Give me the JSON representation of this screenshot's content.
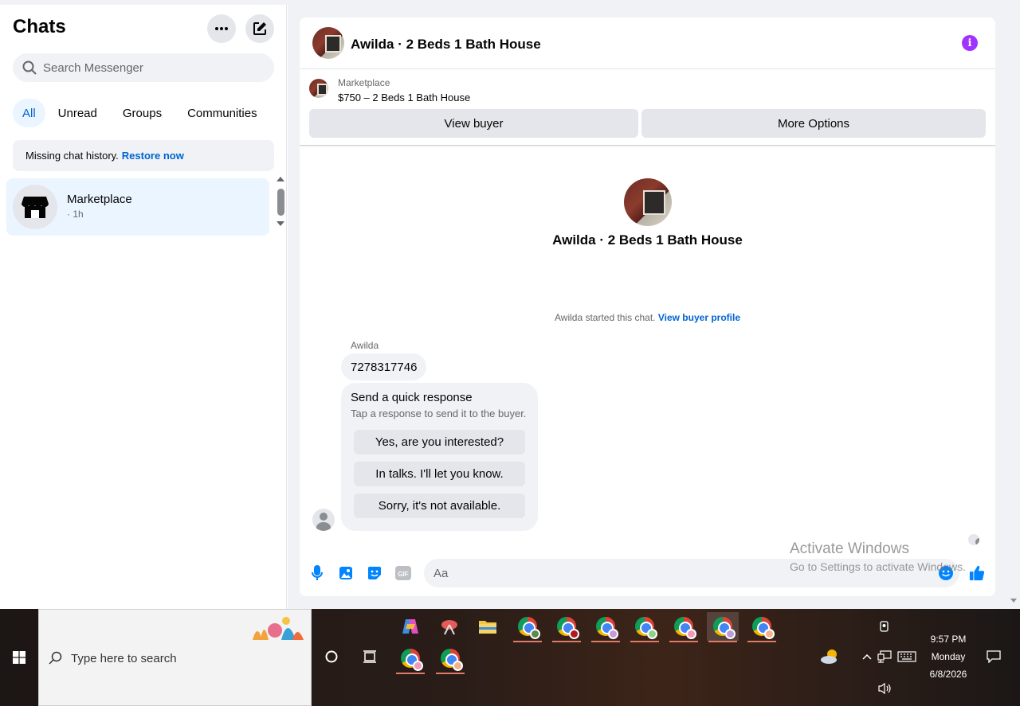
{
  "sidebar": {
    "title": "Chats",
    "search_placeholder": "Search Messenger",
    "filters": [
      "All",
      "Unread",
      "Groups",
      "Communities"
    ],
    "missing_history": {
      "text": "Missing chat history.",
      "link": "Restore now"
    },
    "chats": [
      {
        "name": "Marketplace",
        "time": "· 1h"
      }
    ]
  },
  "conversation": {
    "title": "Awilda · 2 Beds 1 Bath House",
    "marketplace_label": "Marketplace",
    "listing": "$750 – 2 Beds 1 Bath House",
    "view_buyer": "View buyer",
    "more_options": "More Options",
    "intro_name": "Awilda · 2 Beds 1 Bath House",
    "started_text": "Awilda started this chat.",
    "started_link": "View buyer profile",
    "sender": "Awilda",
    "message": "7278317746",
    "quick_response": {
      "title": "Send a quick response",
      "subtitle": "Tap a response to send it to the buyer.",
      "options": [
        "Yes, are you interested?",
        "In talks. I'll let you know.",
        "Sorry, it's not available."
      ]
    },
    "composer_placeholder": "Aa"
  },
  "watermark": {
    "line1": "Activate Windows",
    "line2": "Go to Settings to activate Windows."
  },
  "taskbar": {
    "search_placeholder": "Type here to search",
    "time": "9:57 PM",
    "day": "Monday",
    "date": "6/8/2026"
  },
  "colors": {
    "accent": "#0064d1",
    "info": "#a033ff",
    "messenger_blue": "#0084ff"
  }
}
